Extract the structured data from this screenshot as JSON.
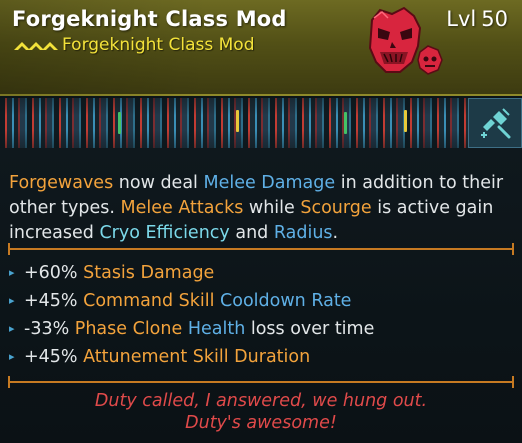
{
  "item": {
    "title": "Forgeknight Class Mod",
    "subtitle": "Forgeknight Class Mod",
    "level_label": "Lvl",
    "level": "50",
    "rarity_icon": "legendary-chevrons-icon",
    "emblem_icon": "forgeknight-skull-emblem-icon",
    "manufacturer_icon": "manufacturer-syringe-icon"
  },
  "colors": {
    "header_background": "#5b5819",
    "subtitle_yellow": "#f3e23a",
    "keyword_orange": "#f3a33c",
    "keyword_blue": "#5fb0e6",
    "keyword_cyan": "#7cd9ea",
    "divider_orange": "#c67a22",
    "flavor_red": "#e04a4a",
    "emblem_red": "#d8253e"
  },
  "description": {
    "parts": [
      {
        "text": "Forgewaves",
        "style": "orange"
      },
      {
        "text": " now deal ",
        "style": "plain"
      },
      {
        "text": "Melee Damage",
        "style": "blue"
      },
      {
        "text": " in addition to their other types. ",
        "style": "plain"
      },
      {
        "text": "Melee Attacks",
        "style": "orange"
      },
      {
        "text": " while ",
        "style": "plain"
      },
      {
        "text": "Scourge",
        "style": "orange"
      },
      {
        "text": " is active gain increased ",
        "style": "plain"
      },
      {
        "text": "Cryo Efficiency",
        "style": "cyan"
      },
      {
        "text": " and ",
        "style": "plain"
      },
      {
        "text": "Radius",
        "style": "blue"
      },
      {
        "text": ".",
        "style": "plain"
      }
    ]
  },
  "stats": [
    {
      "bullet": "▸",
      "parts": [
        {
          "text": "+60% ",
          "style": "plain"
        },
        {
          "text": "Stasis Damage",
          "style": "orange"
        }
      ]
    },
    {
      "bullet": "▸",
      "parts": [
        {
          "text": "+45% ",
          "style": "plain"
        },
        {
          "text": "Command Skill",
          "style": "orange"
        },
        {
          "text": " ",
          "style": "plain"
        },
        {
          "text": "Cooldown Rate",
          "style": "blue"
        }
      ]
    },
    {
      "bullet": "▸",
      "parts": [
        {
          "text": "-33% ",
          "style": "plain"
        },
        {
          "text": "Phase Clone",
          "style": "orange"
        },
        {
          "text": " ",
          "style": "plain"
        },
        {
          "text": "Health",
          "style": "blue"
        },
        {
          "text": " loss over time",
          "style": "plain"
        }
      ]
    },
    {
      "bullet": "▸",
      "parts": [
        {
          "text": "+45% ",
          "style": "plain"
        },
        {
          "text": "Attunement Skill Duration",
          "style": "orange"
        }
      ]
    }
  ],
  "flavor": {
    "line1": "Duty called, I answered, we hung out.",
    "line2": "Duty's awesome!"
  }
}
